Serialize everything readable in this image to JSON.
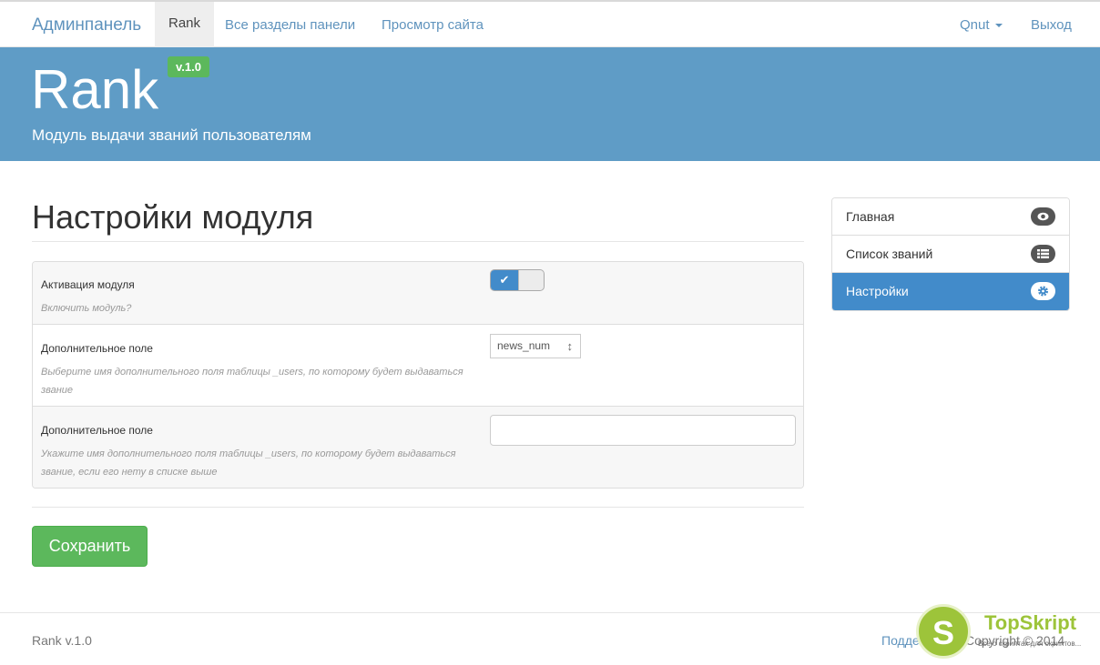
{
  "navbar": {
    "brand": "Админпанель",
    "items": [
      {
        "label": "Rank",
        "active": true
      },
      {
        "label": "Все разделы панели"
      },
      {
        "label": "Просмотр сайта"
      }
    ],
    "user": "Qnut",
    "logout": "Выход"
  },
  "hero": {
    "title": "Rank",
    "version": "v.1.0",
    "subtitle": "Модуль выдачи званий пользователям"
  },
  "page": {
    "title": "Настройки модуля"
  },
  "settings": {
    "rows": [
      {
        "label": "Активация модуля",
        "hint": "Включить модуль?",
        "toggle_on": true
      },
      {
        "label": "Дополнительное поле",
        "hint": "Выберите имя дополнительного поля таблицы _users, по которому будет выдаваться звание",
        "select_value": "news_num"
      },
      {
        "label": "Дополнительное поле",
        "hint": "Укажите имя дополнительного поля таблицы _users, по которому будет выдаваться звание, если его нету в списке выше",
        "input_value": ""
      }
    ],
    "save_label": "Сохранить"
  },
  "sidebar": {
    "items": [
      {
        "label": "Главная",
        "icon": "eye-icon"
      },
      {
        "label": "Список званий",
        "icon": "list-icon"
      },
      {
        "label": "Настройки",
        "icon": "gear-icon",
        "active": true
      }
    ]
  },
  "footer": {
    "left": "Rank v.1.0",
    "link": "Подде",
    "copyright": "Copyright © 2014"
  },
  "watermark": {
    "letter": "S",
    "name": "TopSkript",
    "tagline": "Все о скриптах для скриптов..."
  },
  "colors": {
    "hero_bg": "#5f9cc6",
    "accent": "#428bca",
    "success": "#5cb85c",
    "link": "#5f93bd"
  }
}
